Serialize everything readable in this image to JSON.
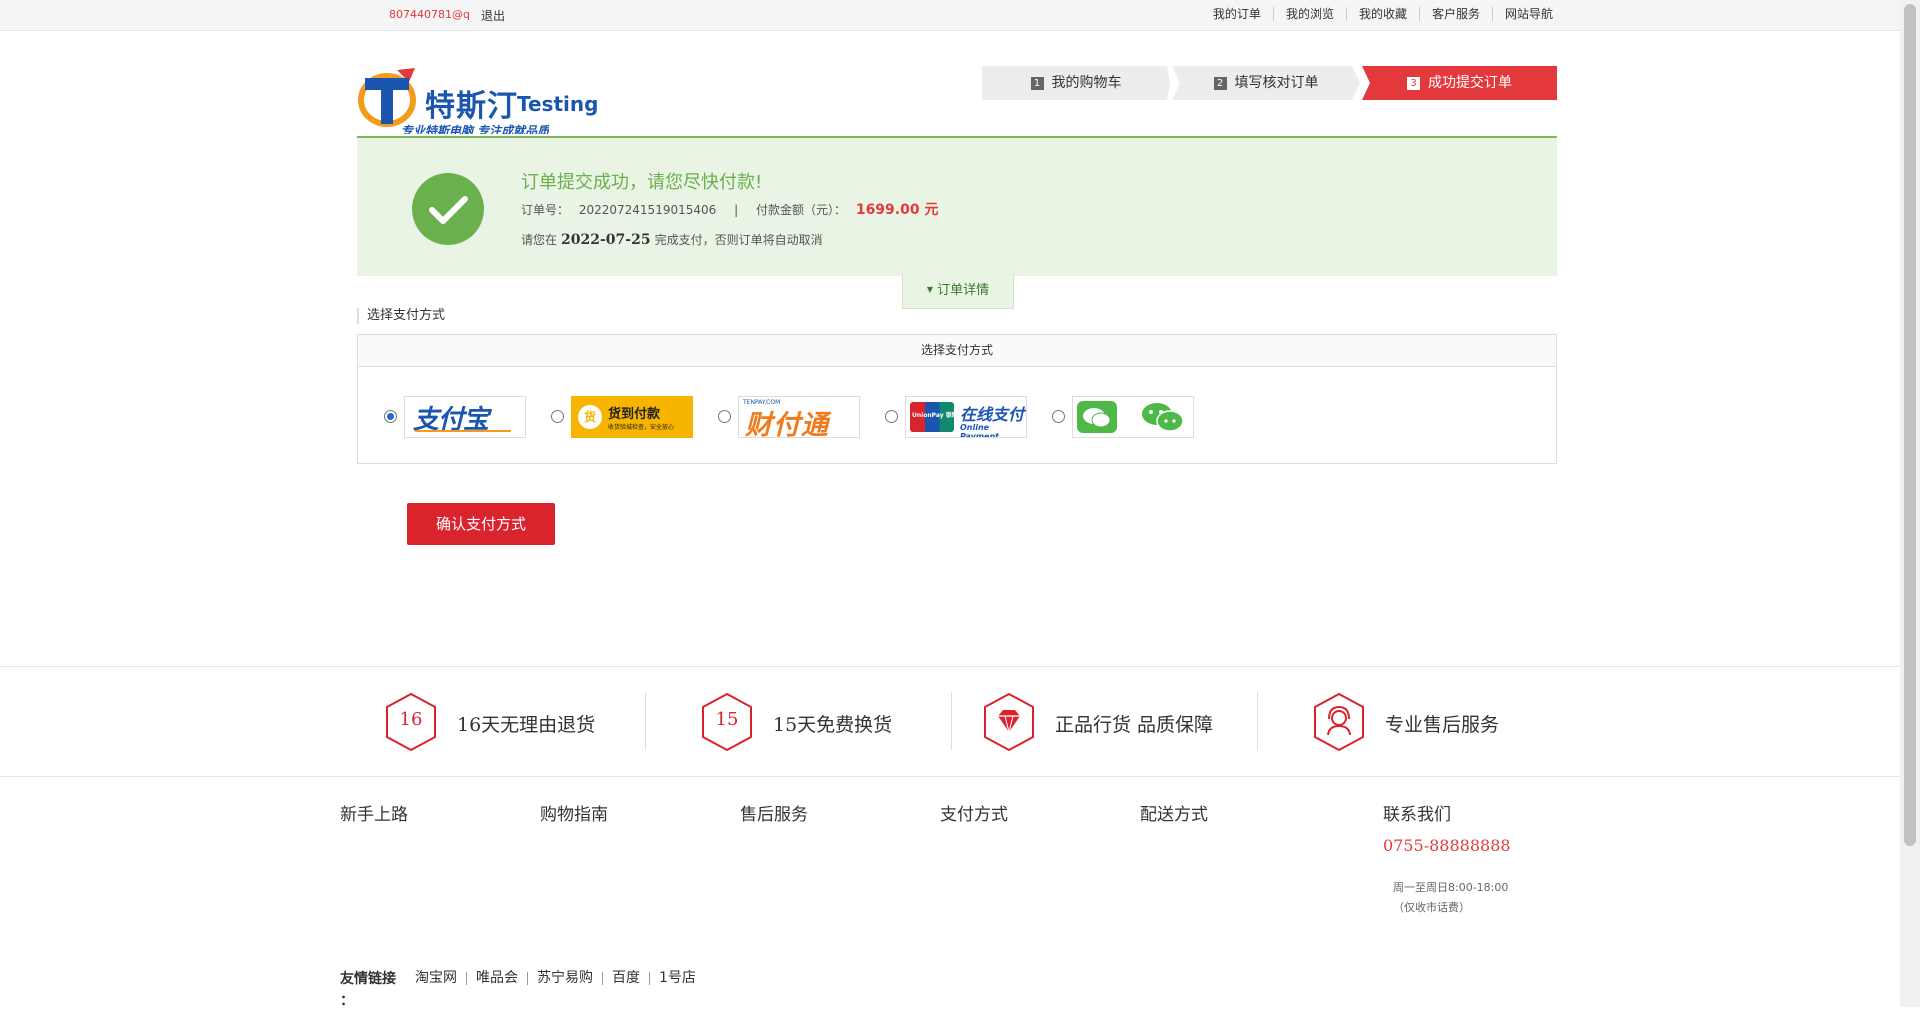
{
  "topbar": {
    "user": "807440781@q",
    "logout": "退出",
    "links": [
      "我的订单",
      "我的浏览",
      "我的收藏",
      "客户服务",
      "网站导航"
    ]
  },
  "logo": {
    "brand_cn": "特斯汀",
    "brand_en": "Testing",
    "slogan": "专业特斯电脑 专注成就品质"
  },
  "steps": [
    {
      "num": "1",
      "label": "我的购物车"
    },
    {
      "num": "2",
      "label": "填写核对订单"
    },
    {
      "num": "3",
      "label": "成功提交订单"
    }
  ],
  "success": {
    "title": "订单提交成功，请您尽快付款!",
    "order_label": "订单号：",
    "order_no": "202207241519015406",
    "separator": "|",
    "amount_label": "付款金额（元）：",
    "amount": "1699.00 元",
    "deadline_prefix": "请您在",
    "deadline_date": "2022-07-25",
    "deadline_suffix": "完成支付，否则订单将自动取消",
    "detail_tab": "订单详情"
  },
  "payment": {
    "section_title": "选择支付方式",
    "box_title": "选择支付方式",
    "methods": [
      {
        "name": "支付宝",
        "selected": true
      },
      {
        "name": "货到付款",
        "sub": "收货验城检查，安全放心",
        "selected": false
      },
      {
        "name": "财付通",
        "sub": "TENPAY.COM",
        "selected": false
      },
      {
        "name": "在线支付",
        "sub": "Online Payment",
        "badge": "UnionPay 银联",
        "selected": false
      },
      {
        "name": "微信支付",
        "selected": false
      }
    ],
    "confirm": "确认支付方式"
  },
  "services": [
    {
      "icon": "16",
      "label": "16天无理由退货"
    },
    {
      "icon": "15",
      "label": "15天免费换货"
    },
    {
      "icon": "diamond-icon",
      "label": "正品行货 品质保障"
    },
    {
      "icon": "headset-icon",
      "label": "专业售后服务"
    }
  ],
  "footer": {
    "columns": [
      "新手上路",
      "购物指南",
      "售后服务",
      "支付方式",
      "配送方式"
    ],
    "contact_title": "联系我们",
    "phone": "0755-88888888",
    "hours": "周一至周日8:00-18:00",
    "hours_note": "（仅收市话费）",
    "friends_title": "友情链接",
    "friends_colon": "：",
    "friends": [
      "淘宝网",
      "唯品会",
      "苏宁易购",
      "百度",
      "1号店"
    ]
  },
  "colors": {
    "accent": "#e4393c",
    "success_green": "#6ab04c",
    "success_bg": "#e9f4e4",
    "brand_blue": "#1a56b0"
  }
}
